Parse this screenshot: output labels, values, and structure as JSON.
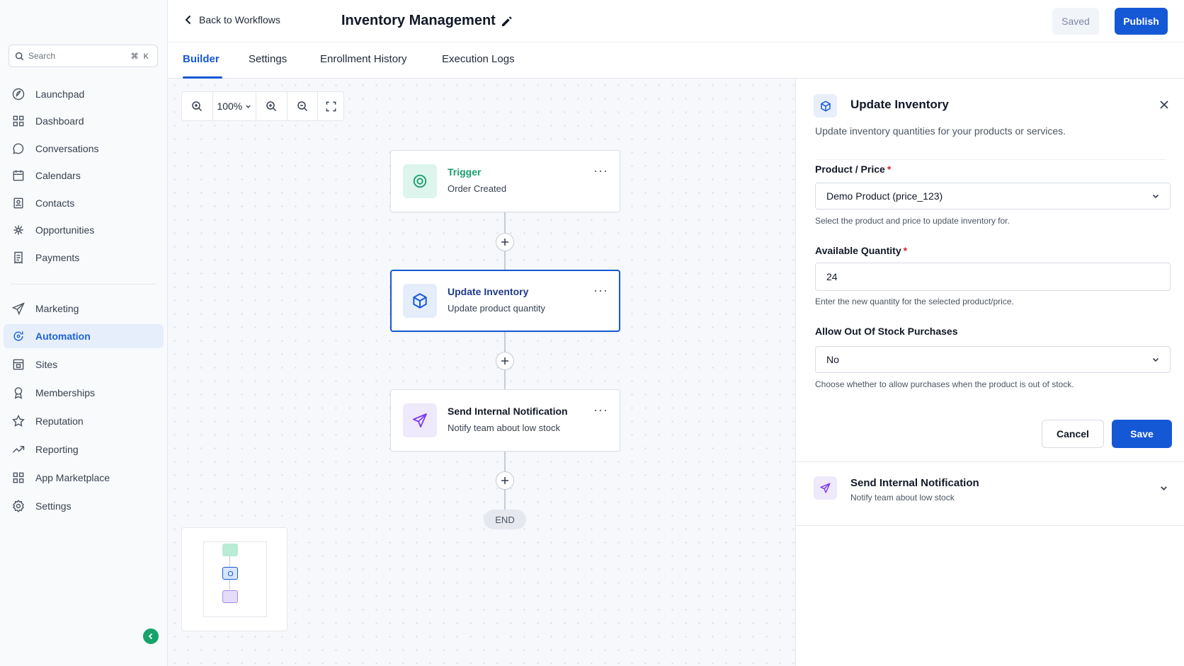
{
  "sidebar": {
    "search_placeholder": "Search",
    "search_shortcut": "⌘ K",
    "items": [
      {
        "label": "Launchpad",
        "icon": "rocket-icon"
      },
      {
        "label": "Dashboard",
        "icon": "grid-icon"
      },
      {
        "label": "Conversations",
        "icon": "chat-icon"
      },
      {
        "label": "Calendars",
        "icon": "calendar-icon"
      },
      {
        "label": "Contacts",
        "icon": "contacts-icon"
      },
      {
        "label": "Opportunities",
        "icon": "opportunities-icon"
      },
      {
        "label": "Payments",
        "icon": "receipt-icon"
      },
      {
        "label": "Marketing",
        "icon": "send-icon"
      },
      {
        "label": "Automation",
        "icon": "automation-icon",
        "active": true
      },
      {
        "label": "Sites",
        "icon": "sites-icon"
      },
      {
        "label": "Memberships",
        "icon": "badge-icon"
      },
      {
        "label": "Reputation",
        "icon": "star-icon"
      },
      {
        "label": "Reporting",
        "icon": "trend-icon"
      },
      {
        "label": "App Marketplace",
        "icon": "apps-icon"
      },
      {
        "label": "Settings",
        "icon": "gear-icon"
      }
    ]
  },
  "header": {
    "back_label": "Back to Workflows",
    "workflow_title": "Inventory Management",
    "saved_label": "Saved",
    "publish_label": "Publish"
  },
  "tabs": [
    {
      "label": "Builder",
      "active": true
    },
    {
      "label": "Settings"
    },
    {
      "label": "Enrollment History"
    },
    {
      "label": "Execution Logs"
    }
  ],
  "canvas": {
    "zoom_level": "100%",
    "nodes": [
      {
        "title": "Trigger",
        "subtitle": "Order Created",
        "icon": "target-icon",
        "accent": "#1a9e6e"
      },
      {
        "title": "Update Inventory",
        "subtitle": "Update product quantity",
        "icon": "box-icon",
        "accent": "#1558d6",
        "selected": true
      },
      {
        "title": "Send Internal Notification",
        "subtitle": "Notify team about low stock",
        "icon": "send-icon",
        "accent": "#7c3aed"
      }
    ],
    "end_label": "END"
  },
  "panel": {
    "title": "Update Inventory",
    "description": "Update inventory quantities for your products or services.",
    "fields": {
      "product": {
        "label": "Product / Price",
        "required_mark": "*",
        "value": "Demo Product (price_123)",
        "help": "Select the product and price to update inventory for."
      },
      "quantity": {
        "label": "Available Quantity",
        "required_mark": "*",
        "value": "24",
        "help": "Enter the new quantity for the selected product/price."
      },
      "allow_oos": {
        "label": "Allow Out Of Stock Purchases",
        "value": "No",
        "help": "Choose whether to allow purchases when the product is out of stock."
      }
    },
    "cancel_label": "Cancel",
    "save_label": "Save",
    "collapsed_step": {
      "title": "Send Internal Notification",
      "subtitle": "Notify team about low stock"
    }
  },
  "colors": {
    "brand": "#1558d6",
    "trigger_accent": "#1a9e6e",
    "notification_accent": "#7c3aed",
    "required": "#dc2626"
  }
}
